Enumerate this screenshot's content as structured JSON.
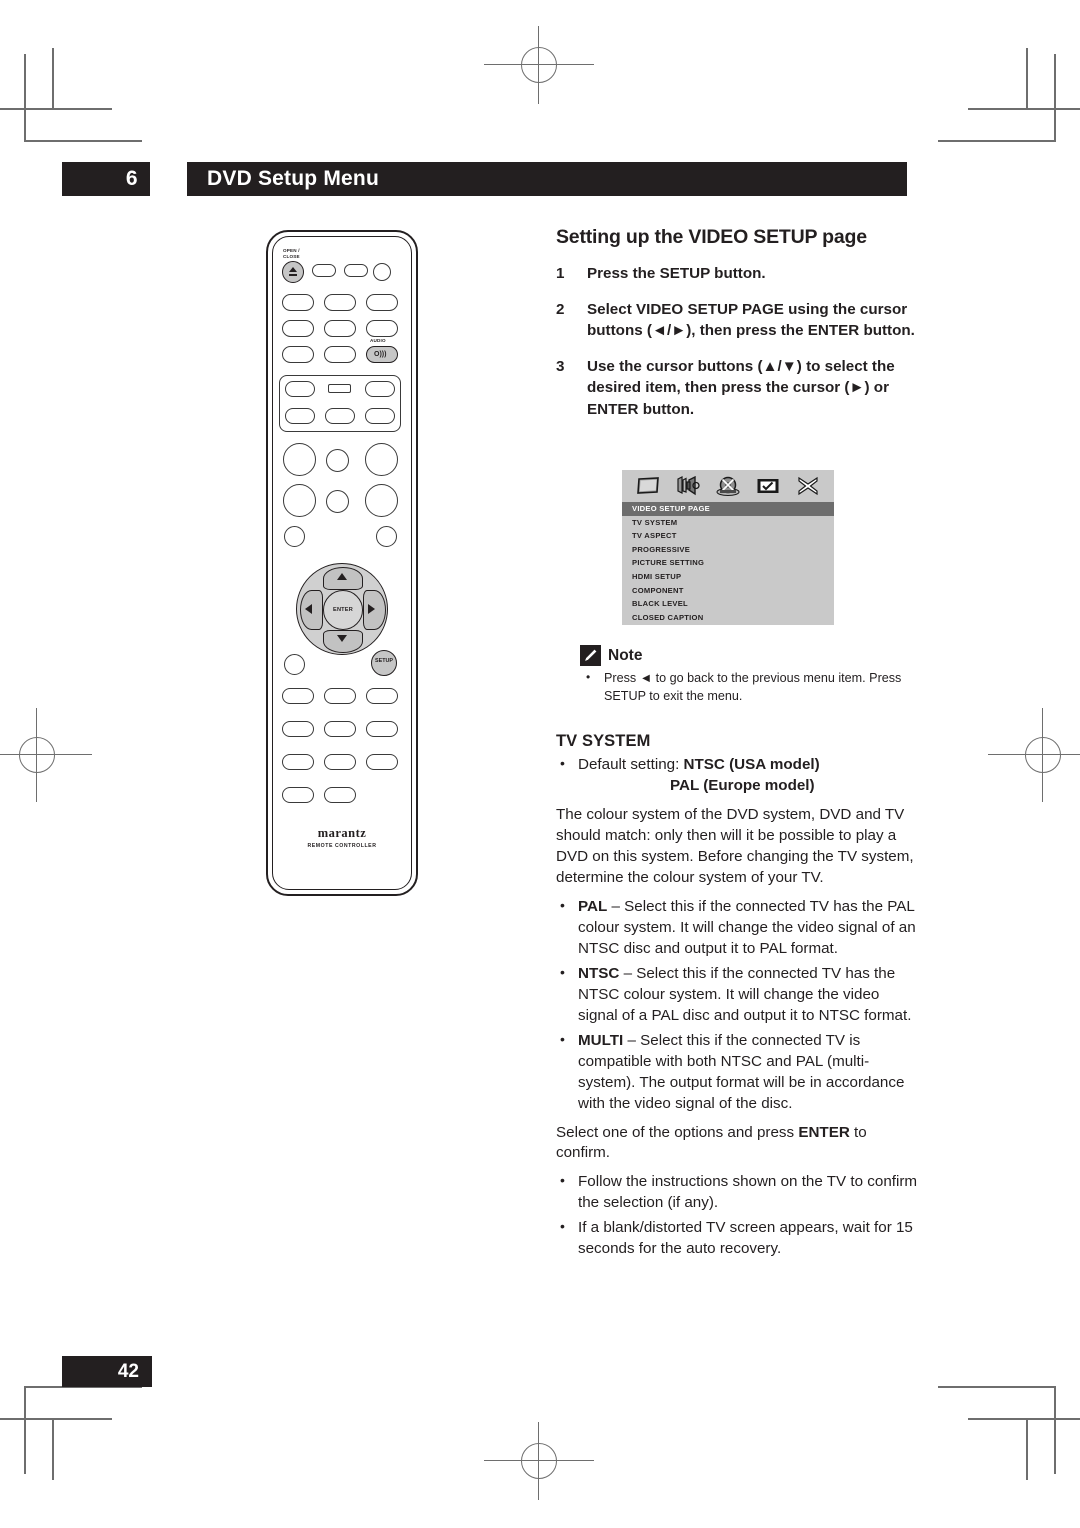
{
  "chapter": {
    "number": "6",
    "title": "DVD Setup Menu"
  },
  "page_number": "42",
  "right_column": {
    "section_title": "Setting up the VIDEO SETUP page",
    "steps": [
      {
        "n": "1",
        "text": "Press the SETUP button."
      },
      {
        "n": "2",
        "text": "Select VIDEO SETUP PAGE using the cursor buttons (◄/►), then press the ENTER button."
      },
      {
        "n": "3",
        "text": "Use the cursor buttons (▲/▼) to select the desired item, then press the cursor (►) or ENTER button."
      }
    ]
  },
  "osd": {
    "icons": [
      "tv-screen-icon",
      "speaker-icon",
      "disc-icon",
      "preference-icon",
      "exit-x-icon"
    ],
    "selected_row": "VIDEO SETUP PAGE",
    "rows": [
      "VIDEO SETUP PAGE",
      "TV SYSTEM",
      "TV ASPECT",
      "PROGRESSIVE",
      "PICTURE SETTING",
      "HDMI SETUP",
      "COMPONENT",
      "BLACK LEVEL",
      "CLOSED CAPTION"
    ],
    "colors": {
      "panel_bg": "#c9c9c9",
      "selected_bg": "#6d6d6d",
      "selected_fg": "#ffffff"
    }
  },
  "note": {
    "title": "Note",
    "body": "Press ◄ to go back to the previous menu item. Press SETUP to exit the menu."
  },
  "tv_system": {
    "heading": "TV SYSTEM",
    "default_label": "Default setting:",
    "default_usa": "NTSC (USA model)",
    "default_europe": "PAL (Europe model)",
    "intro": "The colour system of the DVD system, DVD and TV should match: only then will it be possible to play a DVD on this system. Before changing the TV system, determine the colour system of your TV.",
    "options": [
      {
        "name": "PAL",
        "text": " – Select this if the connected TV has the PAL colour system. It will change the video signal of an NTSC disc and output it to PAL format."
      },
      {
        "name": "NTSC",
        "text": " – Select this if the connected TV has the NTSC colour system. It will change the video signal of a PAL disc and output it to NTSC format."
      },
      {
        "name": "MULTI",
        "text": " – Select this if the connected TV is compatible with both NTSC and PAL (multi-system). The output format will be in accordance with the video signal of the disc."
      }
    ],
    "confirm_pre": "Select one of the options and press ",
    "confirm_bold": "ENTER",
    "confirm_post": " to confirm.",
    "tips": [
      "Follow the instructions shown on the TV to confirm the selection (if any).",
      "If a blank/distorted TV screen appears, wait for 15 seconds for the auto recovery."
    ]
  },
  "remote": {
    "brand": "marantz",
    "subtitle": "REMOTE CONTROLLER",
    "labels": {
      "open_close_line1": "OPEN /",
      "open_close_line2": "CLOSE",
      "audio": "AUDIO",
      "enter": "ENTER",
      "setup": "SETUP"
    }
  }
}
